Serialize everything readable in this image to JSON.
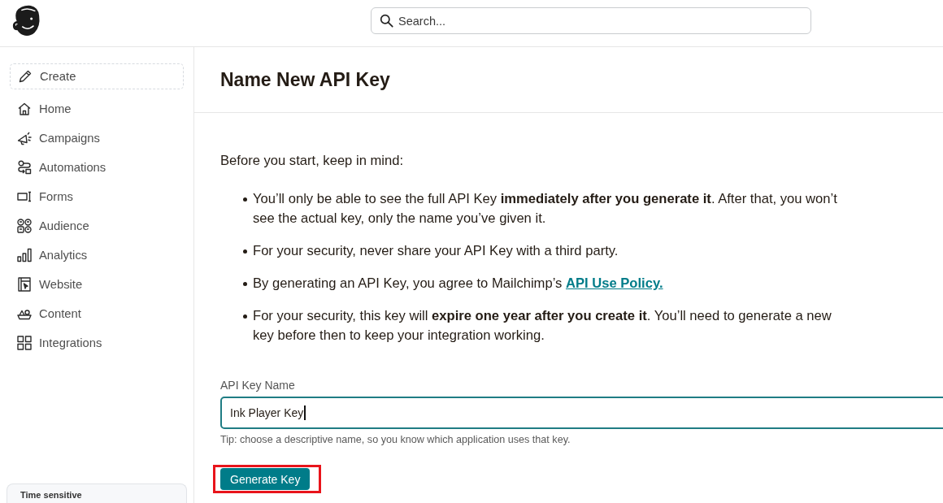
{
  "search": {
    "placeholder": "Search..."
  },
  "sidebar": {
    "create": {
      "label": "Create"
    },
    "items": [
      {
        "label": "Home"
      },
      {
        "label": "Campaigns"
      },
      {
        "label": "Automations"
      },
      {
        "label": "Forms"
      },
      {
        "label": "Audience"
      },
      {
        "label": "Analytics"
      },
      {
        "label": "Website"
      },
      {
        "label": "Content"
      },
      {
        "label": "Integrations"
      }
    ],
    "promo_card": {
      "title": "Time sensitive"
    }
  },
  "page": {
    "title": "Name New API Key",
    "intro": "Before you start, keep in mind:",
    "notes": [
      {
        "text": "You’ll only be able to see the full API Key **immediately after you generate it**. After that, you won’t see the actual key, only the name you’ve given it."
      },
      {
        "text": "For your security, never share your API Key with a third party."
      },
      {
        "text": "By generating an API Key, you agree to Mailchimp’s ",
        "link": "API Use Policy."
      },
      {
        "text": "For your security, this key will **expire one year after you create it**. You’ll need to generate a new key before then to keep your integration working."
      }
    ],
    "form": {
      "label": "API Key Name",
      "value": "Ink Player Key",
      "tip": "Tip: choose a descriptive name, so you know which application uses that key.",
      "submit": "Generate Key",
      "submit_highlighted": true
    }
  }
}
